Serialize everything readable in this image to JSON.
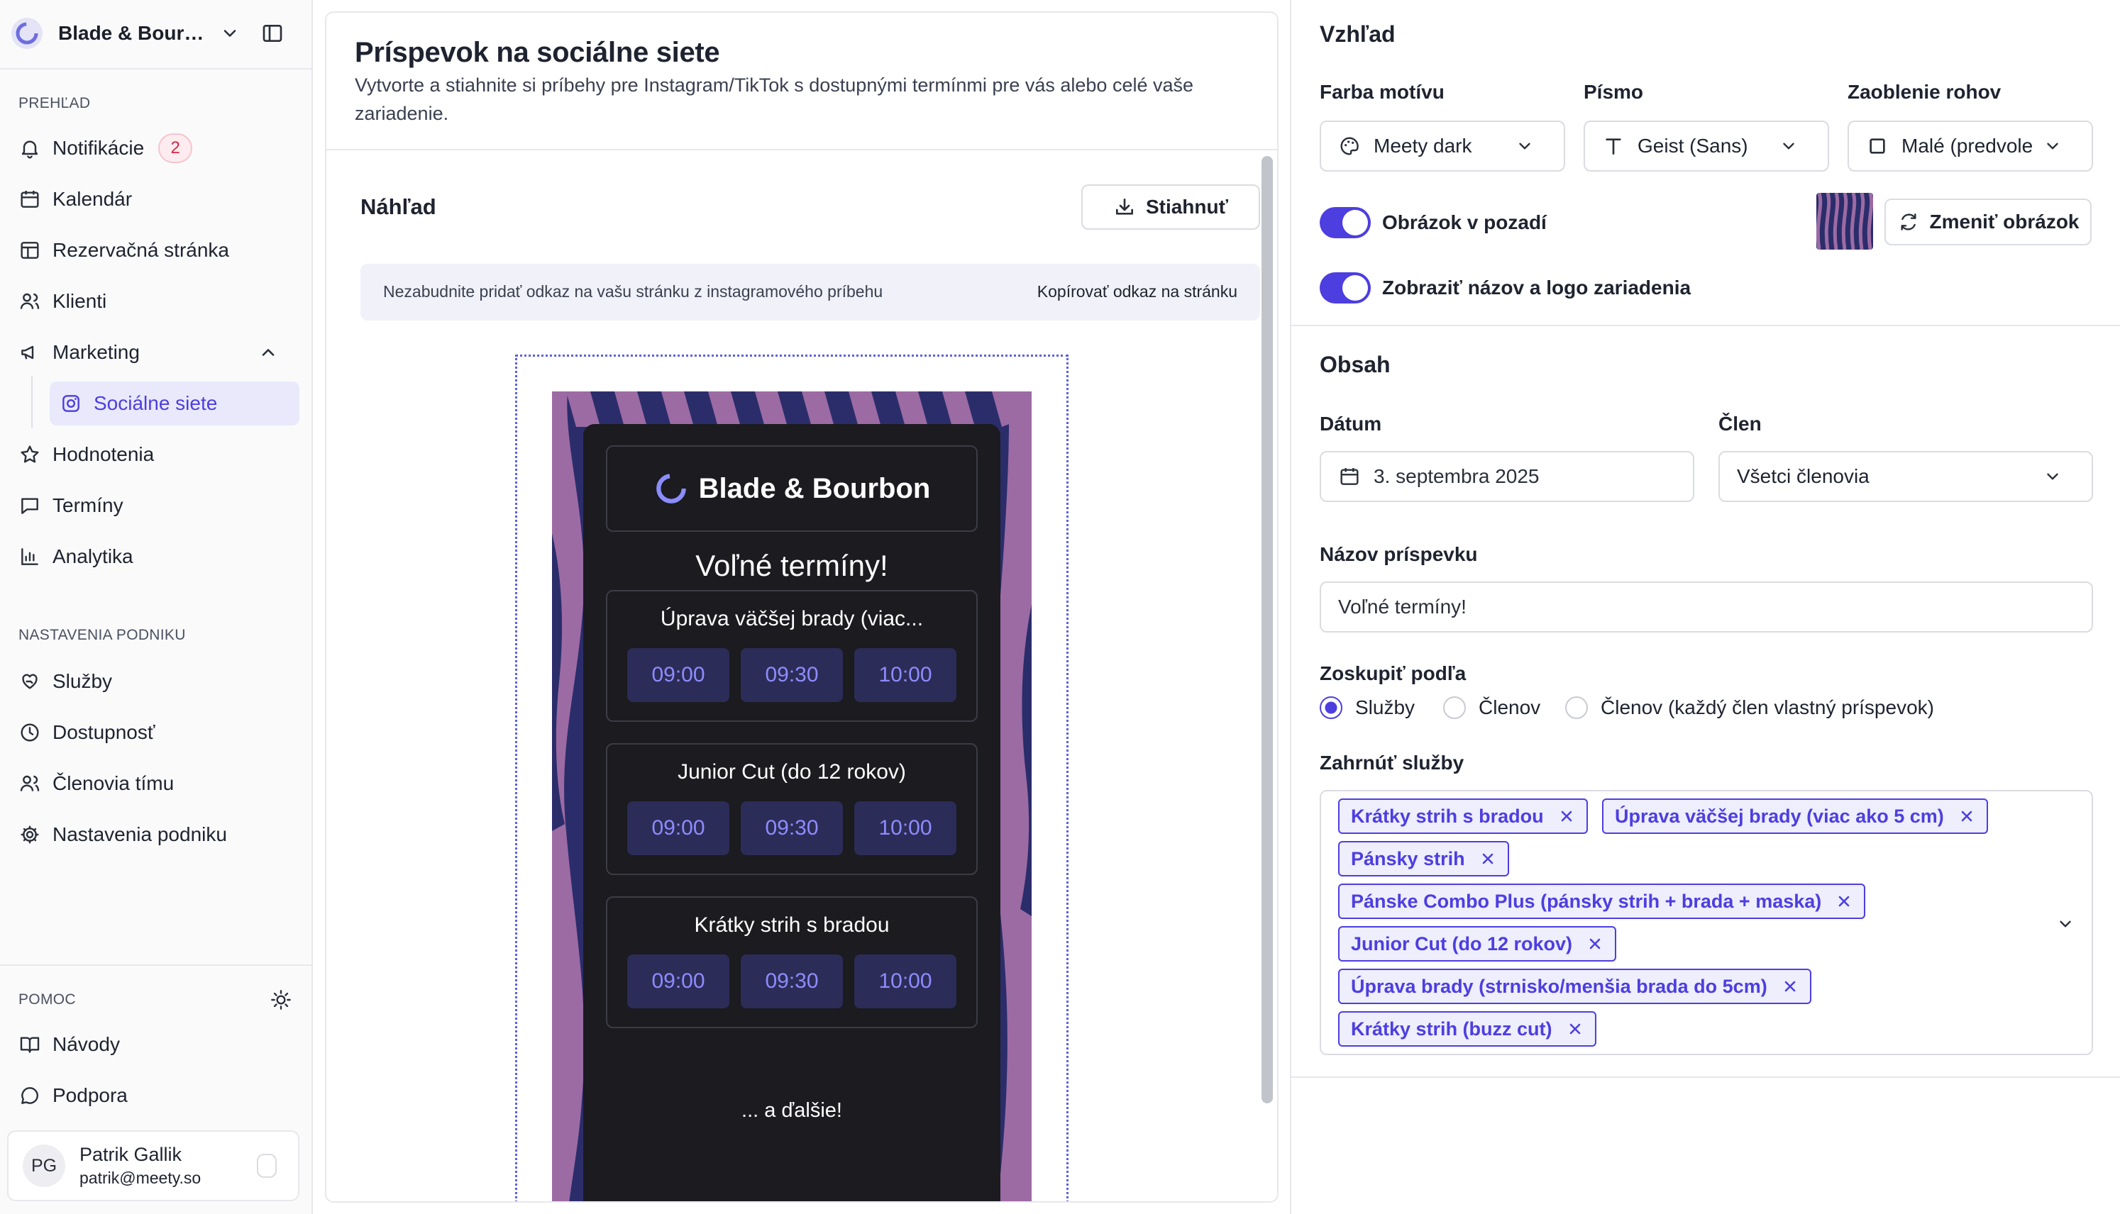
{
  "sidebar": {
    "workspace": "Blade & Bourbon",
    "section_overview": "PREHĽAD",
    "section_business": "NASTAVENIA PODNIKU",
    "section_help": "POMOC",
    "nav": {
      "notifications": {
        "label": "Notifikácie",
        "badge": "2",
        "icon": "bell-icon"
      },
      "calendar": {
        "label": "Kalendár",
        "icon": "calendar-icon"
      },
      "booking": {
        "label": "Rezervačná stránka",
        "icon": "layout-icon"
      },
      "clients": {
        "label": "Klienti",
        "icon": "users-icon"
      },
      "marketing": {
        "label": "Marketing",
        "icon": "megaphone-icon"
      },
      "social": {
        "label": "Sociálne siete",
        "icon": "instagram-icon"
      },
      "reviews": {
        "label": "Hodnotenia",
        "icon": "star-icon"
      },
      "appointments": {
        "label": "Termíny",
        "icon": "message-icon"
      },
      "analytics": {
        "label": "Analytika",
        "icon": "chart-icon"
      },
      "services": {
        "label": "Služby",
        "icon": "heart-hand-icon"
      },
      "availability": {
        "label": "Dostupnosť",
        "icon": "clock-icon"
      },
      "team": {
        "label": "Členovia tímu",
        "icon": "users-icon"
      },
      "settings": {
        "label": "Nastavenia podniku",
        "icon": "gear-icon"
      },
      "guides": {
        "label": "Návody",
        "icon": "book-icon"
      },
      "support": {
        "label": "Podpora",
        "icon": "chat-icon"
      }
    },
    "user": {
      "initials": "PG",
      "name": "Patrik Gallik",
      "email": "patrik@meety.so"
    }
  },
  "main": {
    "title": "Príspevok na sociálne siete",
    "description": "Vytvorte a stiahnite si príbehy pre Instagram/TikTok s dostupnými termínmi pre vás alebo celé vaše zariadenie.",
    "preview_label": "Náhľad",
    "download_label": "Stiahnuť",
    "notice_text": "Nezabudnite pridať odkaz na vašu stránku z instagramového príbehu",
    "copy_link_label": "Kopírovať odkaz na stránku",
    "story": {
      "brand": "Blade & Bourbon",
      "title": "Voľné termíny!",
      "services": [
        {
          "name": "Úprava väčšej brady (viac...",
          "slots": [
            "09:00",
            "09:30",
            "10:00"
          ]
        },
        {
          "name": "Junior Cut (do 12 rokov)",
          "slots": [
            "09:00",
            "09:30",
            "10:00"
          ]
        },
        {
          "name": "Krátky  strih  s bradou",
          "slots": [
            "09:00",
            "09:30",
            "10:00"
          ]
        }
      ],
      "more": "... a ďalšie!"
    }
  },
  "settings": {
    "appearance_title": "Vzhľad",
    "theme_label": "Farba motívu",
    "theme_value": "Meety dark",
    "font_label": "Písmo",
    "font_value": "Geist (Sans)",
    "radius_label": "Zaoblenie rohov",
    "radius_value": "Malé (predvole",
    "bg_toggle_label": "Obrázok v pozadí",
    "bg_toggle_on": true,
    "change_image_label": "Zmeniť obrázok",
    "logo_toggle_label": "Zobraziť názov a logo zariadenia",
    "logo_toggle_on": true,
    "content_title": "Obsah",
    "date_label": "Dátum",
    "date_value": "3. septembra 2025",
    "member_label": "Člen",
    "member_value": "Všetci členovia",
    "post_title_label": "Názov príspevku",
    "post_title_value": "Voľné termíny!",
    "group_label": "Zoskupiť podľa",
    "group_options": [
      "Služby",
      "Členov",
      "Členov (každý člen vlastný príspevok)"
    ],
    "group_selected": "Služby",
    "include_label": "Zahrnúť služby",
    "included_services": [
      "Krátky strih s bradou",
      "Úprava väčšej brady (viac ako 5 cm)",
      "Pánsky strih",
      "Pánske Combo Plus (pánsky strih + brada + maska)",
      "Junior Cut (do 12 rokov)",
      "Úprava brady (strnisko/menšia brada do 5cm)",
      "Krátky strih (buzz cut)"
    ]
  },
  "colors": {
    "accent": "#4d3ee0",
    "story_wave_dark": "#2b2d6b",
    "story_wave_light": "#9c6ba4",
    "card": "#1b1b20",
    "slot_bg": "#2c2c58",
    "slot_text": "#8d8cff",
    "badge": "#d92745"
  }
}
